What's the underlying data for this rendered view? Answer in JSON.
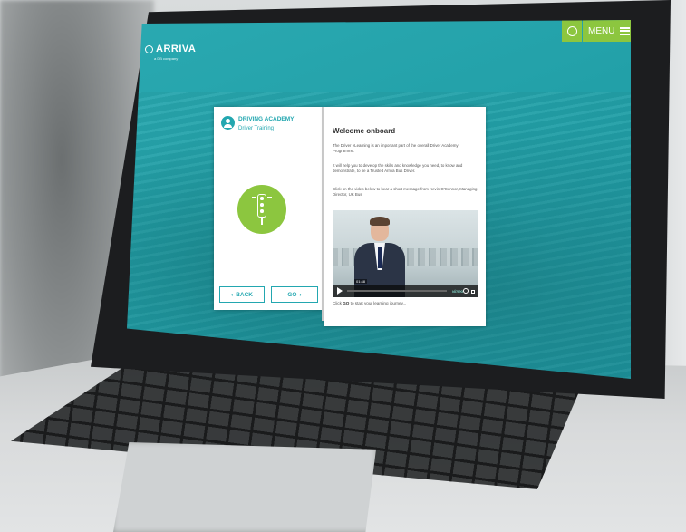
{
  "header": {
    "logo_text": "ARRIVA",
    "logo_subtext": "a DB company",
    "menu_label": "MENU",
    "badge_icon": "medal-icon"
  },
  "left_panel": {
    "title": "DRIVING ACADEMY",
    "subtitle": "Driver Training",
    "icon": "traffic-light-icon",
    "back_label": "BACK",
    "go_label": "GO"
  },
  "right_panel": {
    "heading": "Welcome onboard",
    "para1": "The Driver eLearning is an important part of the overall Driver Academy Programme.",
    "para2": "It will help you to develop the skills and knowledge you need, to know and demonstrate, to be a Trusted Arriva Bus Driver.",
    "para3": "Click on the video below to hear a short message from Kevin O'Connor, Managing Director, UK Bus",
    "video_time": "01:48",
    "video_brand": "vimeo",
    "caption_prefix": "Click ",
    "caption_go": "GO",
    "caption_suffix": " to start your learning journey..."
  },
  "colors": {
    "teal": "#23a7b0",
    "green": "#8cc63f"
  }
}
